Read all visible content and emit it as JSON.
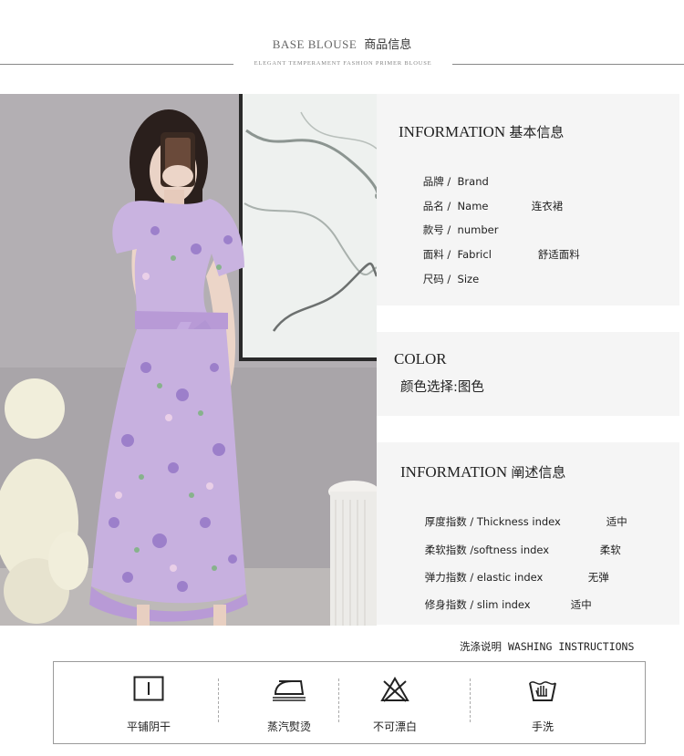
{
  "header": {
    "title_en": "BASE BLOUSE",
    "title_cn": "商品信息",
    "subtitle": "ELEGANT TEMPERAMENT FASHION PRIMER BLOUSE"
  },
  "photo": {
    "icon": "product-model-photo"
  },
  "basic_info": {
    "heading_en": "INFORMATION",
    "heading_cn": "基本信息",
    "rows": [
      {
        "label": "品牌 /  Brand",
        "value": ""
      },
      {
        "label": "品名 /  Name",
        "value": "连衣裙"
      },
      {
        "label": "款号 /  number",
        "value": ""
      },
      {
        "label": "面料 /  Fabricl",
        "value": "舒适面料"
      },
      {
        "label": "尺码 /  Size",
        "value": ""
      }
    ]
  },
  "color_info": {
    "heading": "COLOR",
    "value": "颜色选择:图色"
  },
  "detail_info": {
    "heading_en": "INFORMATION",
    "heading_cn": "阐述信息",
    "rows": [
      {
        "label": "厚度指数 / Thickness index",
        "value": "适中"
      },
      {
        "label": "柔软指数 /softness index",
        "value": "柔软"
      },
      {
        "label": "弹力指数 / elastic index",
        "value": "无弹"
      },
      {
        "label": "修身指数 / slim index",
        "value": "适中"
      }
    ]
  },
  "washing": {
    "title_cn": "洗涤说明",
    "title_en": "WASHING INSTRUCTIONS",
    "items": [
      {
        "icon": "flat-dry-shade-icon",
        "label": "平铺阴干"
      },
      {
        "icon": "steam-iron-icon",
        "label": "蒸汽熨烫"
      },
      {
        "icon": "no-bleach-icon",
        "label": "不可漂白"
      },
      {
        "icon": "hand-wash-icon",
        "label": "手洗"
      }
    ]
  },
  "colors": {
    "panel_bg": "#f5f5f5",
    "dress_base": "#c9b3e0",
    "dress_accent": "#9b7fcf",
    "dress_green": "#6db36a"
  }
}
